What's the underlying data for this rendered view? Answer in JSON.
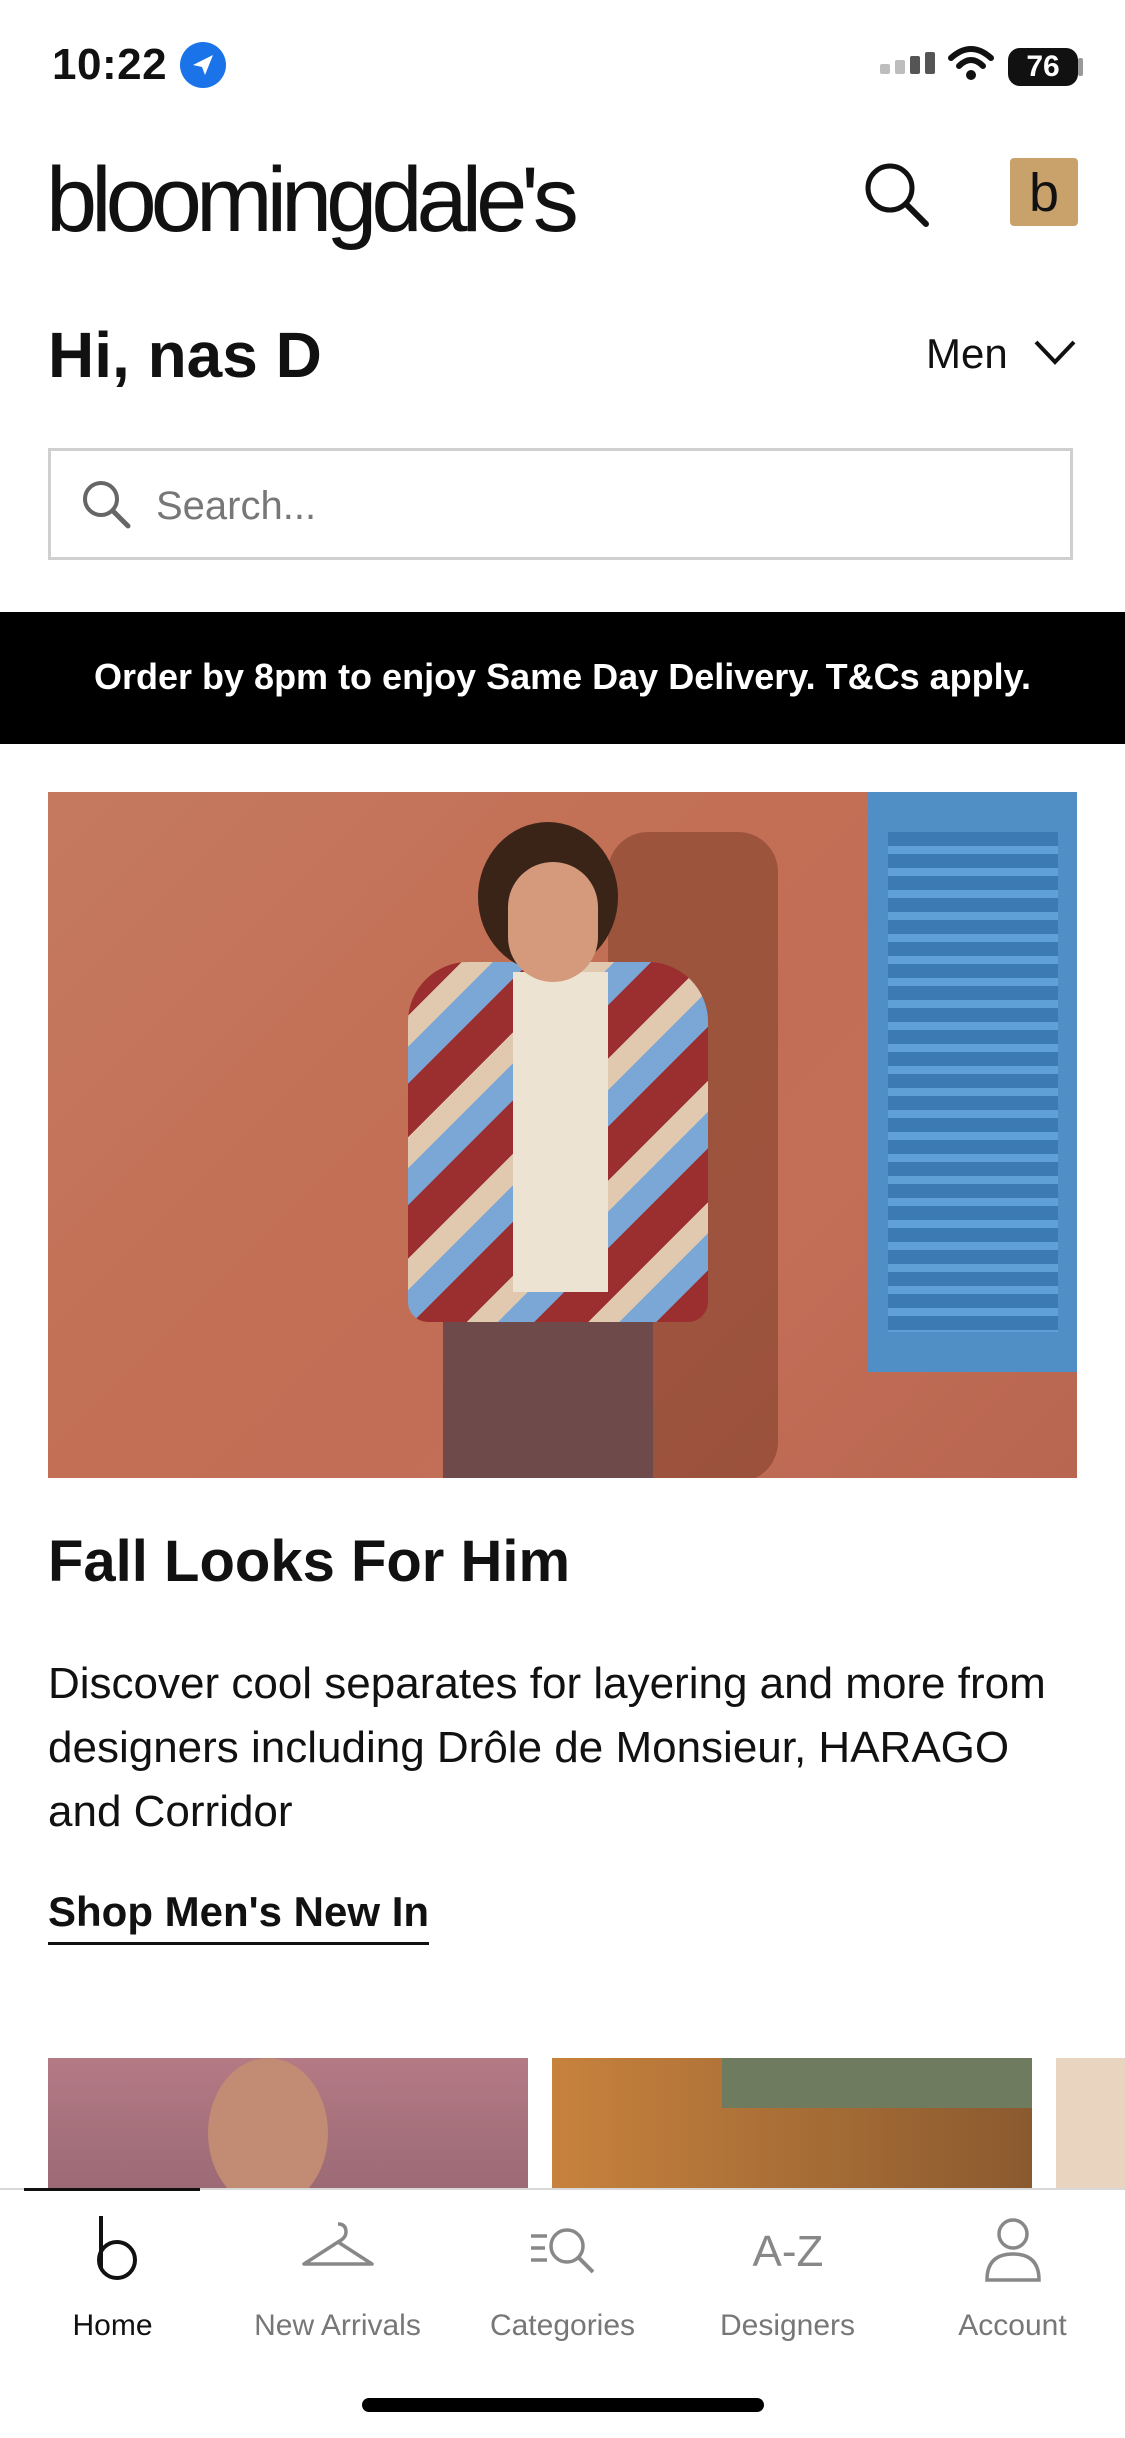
{
  "status_bar": {
    "time": "10:22",
    "battery": "76"
  },
  "header": {
    "logo": "bloomingdale's",
    "bag_letter": "b"
  },
  "greeting": {
    "text": "Hi, nas D",
    "gender": "Men"
  },
  "search": {
    "placeholder": "Search..."
  },
  "promo": {
    "text": "Order by 8pm to enjoy Same Day Delivery. T&Cs apply."
  },
  "article": {
    "title": "Fall Looks For Him",
    "body": "Discover cool separates for layering and more from designers including Drôle de Monsieur, HARAGO and Corridor",
    "cta": "Shop Men's New In"
  },
  "tabs": [
    {
      "label": "Home",
      "icon": "b-logo-icon",
      "active": true
    },
    {
      "label": "New Arrivals",
      "icon": "hanger-icon",
      "active": false
    },
    {
      "label": "Categories",
      "icon": "categories-search-icon",
      "active": false
    },
    {
      "label": "Designers",
      "icon": "a-z-icon",
      "active": false
    },
    {
      "label": "Account",
      "icon": "person-icon",
      "active": false
    }
  ],
  "colors": {
    "accent_bag": "#c8a26a",
    "promo_bg": "#000000",
    "location": "#1a73e8"
  }
}
